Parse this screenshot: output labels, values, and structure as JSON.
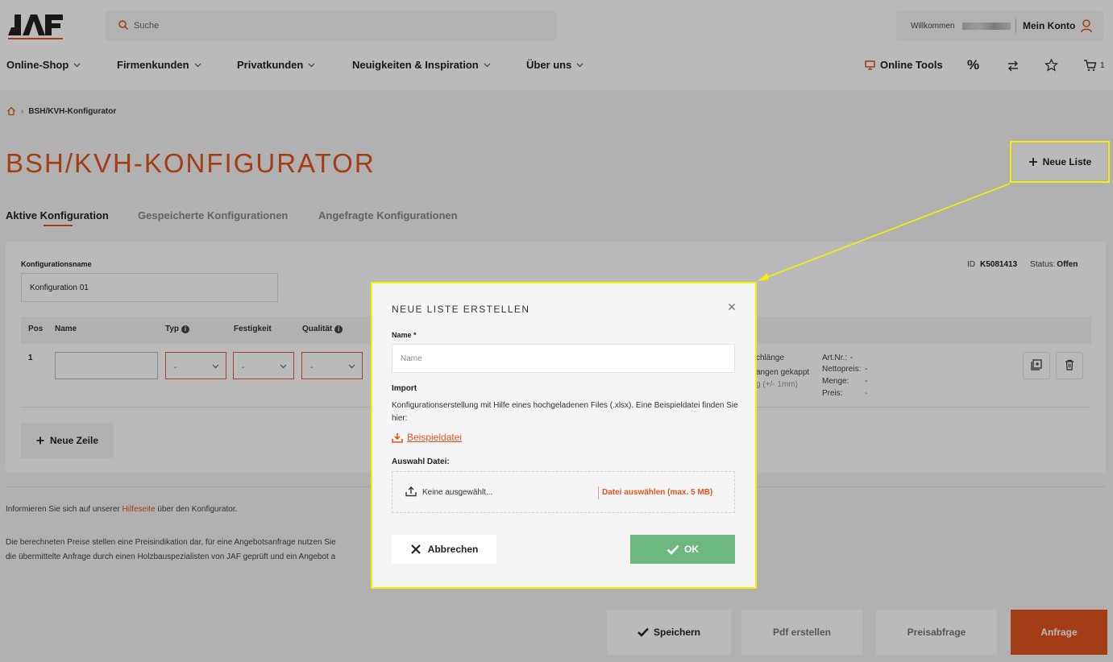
{
  "header": {
    "logo_text": "JAF",
    "search_placeholder": "Suche",
    "welcome": "Willkommen",
    "my_account": "Mein Konto",
    "nav": [
      "Online-Shop",
      "Firmenkunden",
      "Privatkunden",
      "Neuigkeiten & Inspiration",
      "Über uns"
    ],
    "online_tools": "Online Tools",
    "percent_symbol": "%",
    "cart_count": "1"
  },
  "breadcrumb": {
    "current": "BSH/KVH-Konfigurator"
  },
  "page": {
    "title": "BSH/KVH-KONFIGURATOR",
    "new_list_label": "Neue Liste",
    "tabs": [
      "Aktive Konfiguration",
      "Gespeicherte Konfigurationen",
      "Angefragte Konfigurationen"
    ]
  },
  "config": {
    "name_label": "Konfigurationsname",
    "name_value": "Konfiguration 01",
    "id_label": "ID",
    "id_value": "K5081413",
    "status_label": "Status:",
    "status_value": "Offen",
    "columns": [
      "Pos",
      "Name",
      "Typ",
      "Festigkeit",
      "Qualität"
    ],
    "row": {
      "pos": "1",
      "select_placeholder": "-",
      "extra_1": "chlänge",
      "extra_2": "angen gekappt",
      "extra_3": "g (+/- 1mm)",
      "art_label": "Art.Nr.:",
      "art_value": "-",
      "net_label": "Nettopreis:",
      "net_value": "-",
      "qty_label": "Menge:",
      "qty_value": "-",
      "price_label": "Preis:",
      "price_value": "-"
    },
    "new_row_label": "Neue Zeile"
  },
  "footer": {
    "info_prefix": "Informieren Sie sich auf unserer ",
    "help_link": "Hilfeseite",
    "info_suffix": " über den Konfigurator.",
    "disclaimer_1": "Die berechneten Preise stellen eine Preisindikation dar, für eine Angebotsanfrage nutzen Sie",
    "disclaimer_2": "die übermittelte Anfrage durch einen Holzbauspezialisten von JAF geprüft und ein Angebot a"
  },
  "actions": {
    "save": "Speichern",
    "pdf": "Pdf erstellen",
    "price_request": "Preisabfrage",
    "request": "Anfrage"
  },
  "modal": {
    "title": "NEUE LISTE ERSTELLEN",
    "name_label": "Name *",
    "name_placeholder": "Name",
    "import_label": "Import",
    "import_desc": "Konfigurationserstellung mit Hilfe eines hochgeladenen Files (.xlsx). Eine Beispieldatei finden Sie hier:",
    "example_link": "Beispieldatei",
    "file_label": "Auswahl Datei:",
    "file_none": "Keine ausgewählt...",
    "file_choose": "Datei auswählen (max. 5 MB)",
    "cancel": "Abbrechen",
    "ok": "OK"
  },
  "colors": {
    "accent": "#e0541e",
    "highlight": "#f4f000",
    "ok_green": "#6db87e"
  }
}
